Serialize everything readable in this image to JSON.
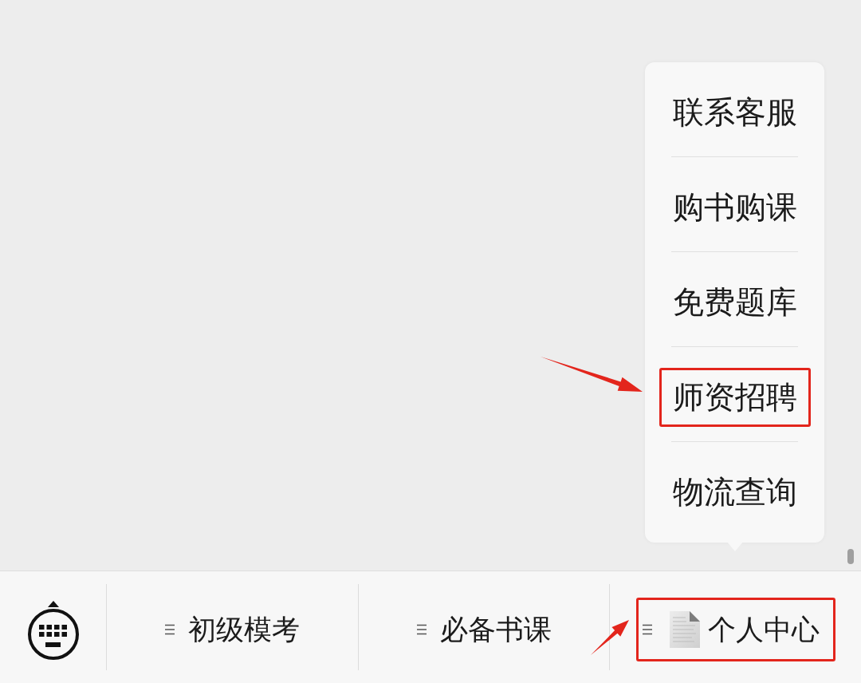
{
  "popup_menu": {
    "items": [
      {
        "label": "联系客服",
        "highlighted": false
      },
      {
        "label": "购书购课",
        "highlighted": false
      },
      {
        "label": "免费题库",
        "highlighted": false
      },
      {
        "label": "师资招聘",
        "highlighted": true
      },
      {
        "label": "物流查询",
        "highlighted": false
      }
    ]
  },
  "bottom_bar": {
    "tabs": [
      {
        "label": "初级模考",
        "kind": "plain",
        "highlighted": false
      },
      {
        "label": "必备书课",
        "kind": "plain",
        "highlighted": false
      },
      {
        "label": "个人中心",
        "kind": "with_icon",
        "highlighted": true
      }
    ]
  }
}
